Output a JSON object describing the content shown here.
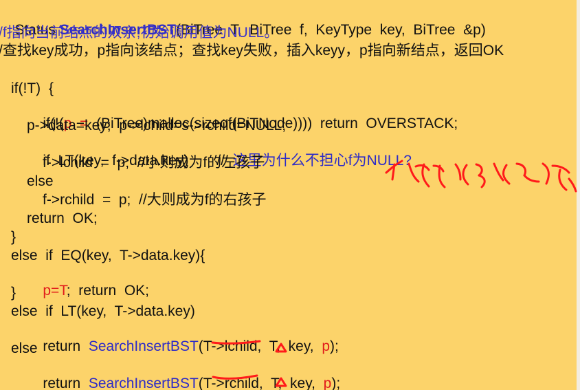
{
  "title": {
    "prefix": "Status ",
    "function_name": "SearchInsertBST",
    "signature": "(BiTree  T,  BiTree  f,  KeyType  key,  BiTree  &p)"
  },
  "comments": {
    "line1": "/f指向当前结点的双亲,初始调用值为NULL。",
    "line2": "/查找key成功，p指向该结点；查找key失败，插入keyy，p指向新结点，返回OK"
  },
  "code": {
    "line1": "if(!T)  {",
    "line2": {
      "a": "if(!(",
      "b": "p  =",
      "c": "  (BiTree)malloc(sizeof(BiTNode))))  return  OVERSTACK;"
    },
    "line3": "p->data=key;  p->lchild=s->rchild=NULL;",
    "line4": {
      "a": "if  LT(key,  f->data.key)       //  ",
      "b": "这里为什么不担心f为NULL?"
    },
    "line5": "f->lchild  =  p;  //小则成为f的左孩子",
    "line6": "else",
    "line7": "f->rchild  =  p;  //大则成为f的右孩子",
    "line8": "return  OK;",
    "line9": "}",
    "line10": "else  if  EQ(key,  T->data.key){",
    "line11": {
      "a": "p=T",
      "b": ";  return  OK;"
    },
    "line12": "}",
    "line13": "else  if  LT(key,  T->data.key)",
    "line14": {
      "a": "return  ",
      "b": "SearchInsertBST",
      "c": "(T->lchild,  T,  key,  ",
      "d": "p",
      "e": ");"
    },
    "line15": "else",
    "line16": {
      "a": "return  ",
      "b": "SearchInsertBST",
      "c": "(T->rchild,  T,  key,  ",
      "d": "p",
      "e": ");"
    }
  },
  "colors": {
    "background": "#fcd36a",
    "keyword_blue": "#2d2bc7",
    "highlight_red": "#e11b1b",
    "annotation_red": "#ff1a1a"
  }
}
